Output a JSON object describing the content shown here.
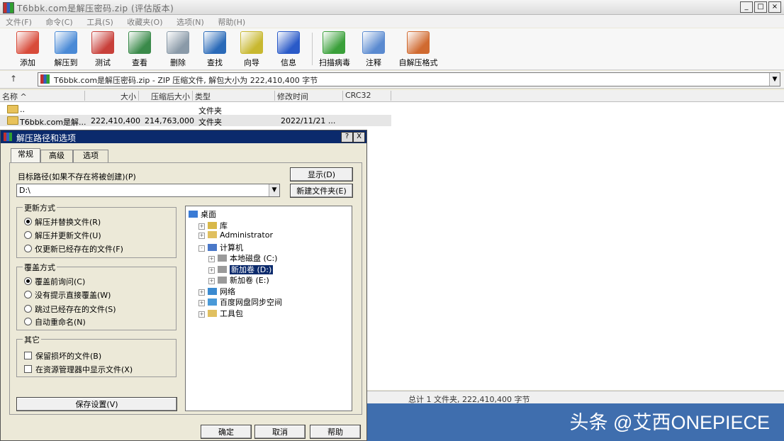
{
  "window": {
    "title": "T6bbk.com是解压密码.zip (评估版本)"
  },
  "menu": [
    "文件(F)",
    "命令(C)",
    "工具(S)",
    "收藏夹(O)",
    "选项(N)",
    "帮助(H)"
  ],
  "toolbar": [
    {
      "label": "添加",
      "icon": "add-archive-icon",
      "color": "#d84b3a"
    },
    {
      "label": "解压到",
      "icon": "extract-to-icon",
      "color": "#4a8ad6"
    },
    {
      "label": "测试",
      "icon": "test-icon",
      "color": "#c8403a"
    },
    {
      "label": "查看",
      "icon": "view-icon",
      "color": "#3a8a4a"
    },
    {
      "label": "删除",
      "icon": "delete-icon",
      "color": "#8a9aa8"
    },
    {
      "label": "查找",
      "icon": "find-icon",
      "color": "#2a6ab8"
    },
    {
      "label": "向导",
      "icon": "wizard-icon",
      "color": "#c8b830"
    },
    {
      "label": "信息",
      "icon": "info-icon",
      "color": "#2a5ac8"
    },
    {
      "label": "扫描病毒",
      "icon": "scan-virus-icon",
      "color": "#3aa03a"
    },
    {
      "label": "注释",
      "icon": "comment-icon",
      "color": "#5a8ad0"
    },
    {
      "label": "自解压格式",
      "icon": "sfx-icon",
      "color": "#d06a30"
    }
  ],
  "address": {
    "text": "T6bbk.com是解压密码.zip - ZIP 压缩文件, 解包大小为 222,410,400 字节"
  },
  "columns": [
    "名称 ^",
    "大小",
    "压缩后大小",
    "类型",
    "修改时间",
    "CRC32"
  ],
  "rows": [
    {
      "name": "..",
      "size": "",
      "packed": "",
      "type": "文件夹",
      "modified": ""
    },
    {
      "name": "T6bbk.com是解...",
      "size": "222,410,400",
      "packed": "214,763,000",
      "type": "文件夹",
      "modified": "2022/11/21 ..."
    }
  ],
  "status": {
    "text": "总计 1 文件夹, 222,410,400 字节"
  },
  "watermark": "头条 @艾西ONEPIECE",
  "dialog": {
    "title": "解压路径和选项",
    "help_btn": "?",
    "close_btn": "X",
    "tabs": [
      "常规",
      "高级",
      "选项"
    ],
    "target_label": "目标路径(如果不存在将被创建)(P)",
    "target_value": "D:\\",
    "show_button": "显示(D)",
    "new_folder_button": "新建文件夹(E)",
    "update_group": {
      "title": "更新方式",
      "options": [
        "解压并替换文件(R)",
        "解压并更新文件(U)",
        "仅更新已经存在的文件(F)"
      ],
      "selected": 0
    },
    "overwrite_group": {
      "title": "覆盖方式",
      "options": [
        "覆盖前询问(C)",
        "没有提示直接覆盖(W)",
        "跳过已经存在的文件(S)",
        "自动重命名(N)"
      ],
      "selected": 0
    },
    "misc_group": {
      "title": "其它",
      "options": [
        "保留损坏的文件(B)",
        "在资源管理器中显示文件(X)"
      ]
    },
    "save_button": "保存设置(V)",
    "tree": [
      {
        "label": "桌面",
        "level": 0,
        "expander": "",
        "icon": "desktop-icon",
        "selected": false
      },
      {
        "label": "库",
        "level": 1,
        "expander": "+",
        "icon": "library-icon",
        "selected": false
      },
      {
        "label": "Administrator",
        "level": 1,
        "expander": "+",
        "icon": "user-folder-icon",
        "selected": false
      },
      {
        "label": "计算机",
        "level": 1,
        "expander": "-",
        "icon": "computer-icon",
        "selected": false
      },
      {
        "label": "本地磁盘 (C:)",
        "level": 2,
        "expander": "+",
        "icon": "drive-icon",
        "selected": false
      },
      {
        "label": "新加卷 (D:)",
        "level": 2,
        "expander": "+",
        "icon": "drive-icon",
        "selected": true
      },
      {
        "label": "新加卷 (E:)",
        "level": 2,
        "expander": "+",
        "icon": "drive-icon",
        "selected": false
      },
      {
        "label": "网络",
        "level": 1,
        "expander": "+",
        "icon": "network-icon",
        "selected": false
      },
      {
        "label": "百度网盘同步空间",
        "level": 1,
        "expander": "+",
        "icon": "cloud-folder-icon",
        "selected": false
      },
      {
        "label": "工具包",
        "level": 1,
        "expander": "+",
        "icon": "folder-icon",
        "selected": false
      }
    ],
    "ok_button": "确定",
    "cancel_button": "取消",
    "help_button": "帮助"
  }
}
